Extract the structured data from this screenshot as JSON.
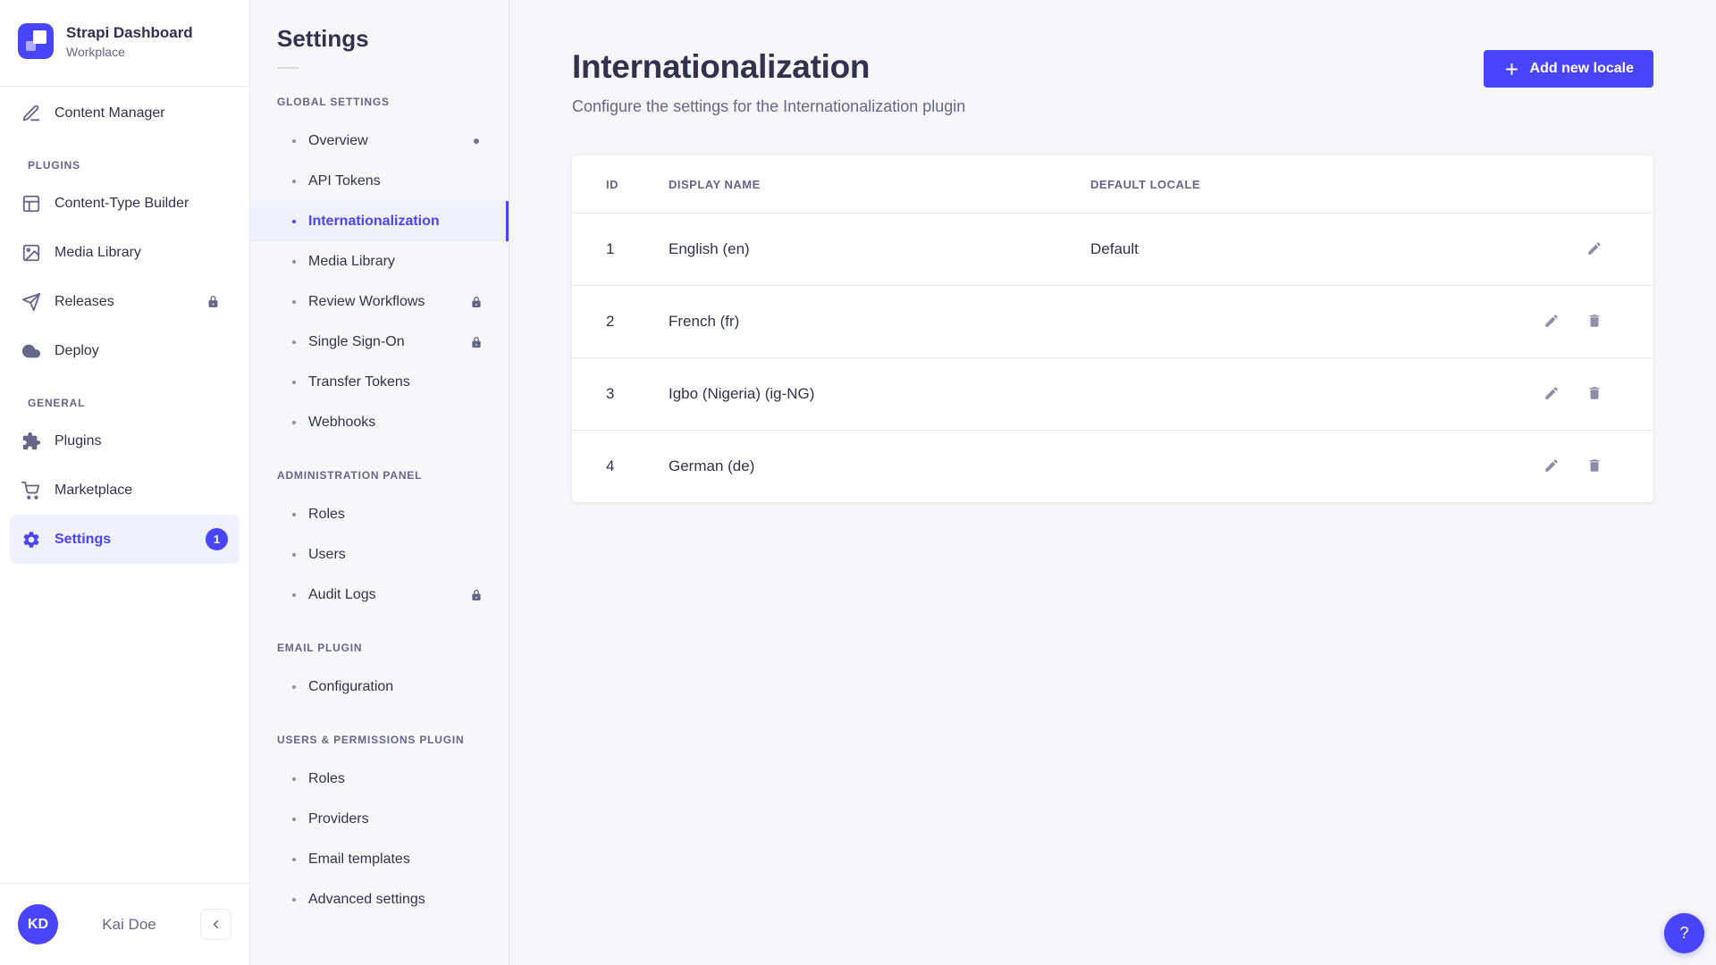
{
  "brand": {
    "title": "Strapi Dashboard",
    "subtitle": "Workplace",
    "logo_icon": "strapi-logo-icon"
  },
  "sidebar": {
    "sections": [
      {
        "label": "",
        "items": [
          {
            "label": "Content Manager",
            "icon": "content-manager-icon"
          }
        ]
      },
      {
        "label": "PLUGINS",
        "items": [
          {
            "label": "Content-Type Builder",
            "icon": "content-type-builder-icon"
          },
          {
            "label": "Media Library",
            "icon": "media-library-icon"
          },
          {
            "label": "Releases",
            "icon": "releases-icon",
            "lock": true
          },
          {
            "label": "Deploy",
            "icon": "deploy-icon"
          }
        ]
      },
      {
        "label": "GENERAL",
        "items": [
          {
            "label": "Plugins",
            "icon": "plugins-icon"
          },
          {
            "label": "Marketplace",
            "icon": "marketplace-icon"
          },
          {
            "label": "Settings",
            "icon": "settings-icon",
            "active": true,
            "badge": "1"
          }
        ]
      }
    ],
    "user": {
      "initials": "KD",
      "name": "Kai Doe"
    }
  },
  "subnav": {
    "title": "Settings",
    "sections": [
      {
        "label": "GLOBAL SETTINGS",
        "items": [
          {
            "label": "Overview",
            "dot": true
          },
          {
            "label": "API Tokens"
          },
          {
            "label": "Internationalization",
            "active": true
          },
          {
            "label": "Media Library"
          },
          {
            "label": "Review Workflows",
            "lock": true
          },
          {
            "label": "Single Sign-On",
            "lock": true
          },
          {
            "label": "Transfer Tokens"
          },
          {
            "label": "Webhooks"
          }
        ]
      },
      {
        "label": "ADMINISTRATION PANEL",
        "items": [
          {
            "label": "Roles"
          },
          {
            "label": "Users"
          },
          {
            "label": "Audit Logs",
            "lock": true
          }
        ]
      },
      {
        "label": "EMAIL PLUGIN",
        "items": [
          {
            "label": "Configuration"
          }
        ]
      },
      {
        "label": "USERS & PERMISSIONS PLUGIN",
        "items": [
          {
            "label": "Roles"
          },
          {
            "label": "Providers"
          },
          {
            "label": "Email templates"
          },
          {
            "label": "Advanced settings"
          }
        ]
      }
    ]
  },
  "main": {
    "title": "Internationalization",
    "subtitle": "Configure the settings for the Internationalization plugin",
    "add_button_label": "Add new locale",
    "table": {
      "columns": [
        "ID",
        "DISPLAY NAME",
        "DEFAULT LOCALE"
      ],
      "rows": [
        {
          "id": "1",
          "display_name": "English (en)",
          "default_locale": "Default",
          "actions": [
            "edit"
          ]
        },
        {
          "id": "2",
          "display_name": "French (fr)",
          "default_locale": "",
          "actions": [
            "edit",
            "delete"
          ]
        },
        {
          "id": "3",
          "display_name": "Igbo (Nigeria) (ig-NG)",
          "default_locale": "",
          "actions": [
            "edit",
            "delete"
          ]
        },
        {
          "id": "4",
          "display_name": "German (de)",
          "default_locale": "",
          "actions": [
            "edit",
            "delete"
          ]
        }
      ]
    }
  },
  "help": {
    "label": "?"
  },
  "colors": {
    "accent": "#4945ff",
    "accent_light_bg": "#f0f0ff",
    "text_dark": "#32324d",
    "text_muted": "#666687",
    "icon_muted": "#8e8ea9",
    "border": "#eaeaef",
    "page_bg": "#f6f6f9"
  }
}
